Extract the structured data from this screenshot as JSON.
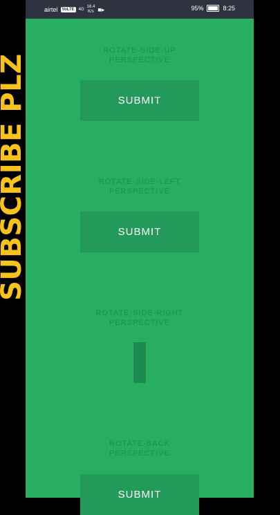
{
  "overlay": {
    "text": "SUBSCRIBE PLZ"
  },
  "statusbar": {
    "carrier": "airtel",
    "volte": "VoLTE",
    "network": "4G",
    "speed_value": "16.4",
    "speed_unit": "K/s",
    "battery": "95%",
    "time": "8:25",
    "battery_level_percent": 95
  },
  "sections": [
    {
      "label_line1": "ROTATE-SIDE-UP",
      "label_line2": "PERSPECTIVE",
      "button": "SUBMIT"
    },
    {
      "label_line1": "ROTATE-SIDE-LEFT",
      "label_line2": "PERSPECTIVE",
      "button": "SUBMIT"
    },
    {
      "label_line1": "ROTATE-SIDE-RIGHT",
      "label_line2": "PERSPECTIVE",
      "button": ""
    },
    {
      "label_line1": "ROTATE-BACK",
      "label_line2": "PERSPECTIVE",
      "button": "SUBMIT"
    }
  ],
  "colors": {
    "background": "#27ae60",
    "button": "#23995a",
    "overlay": "#f6c21b"
  }
}
